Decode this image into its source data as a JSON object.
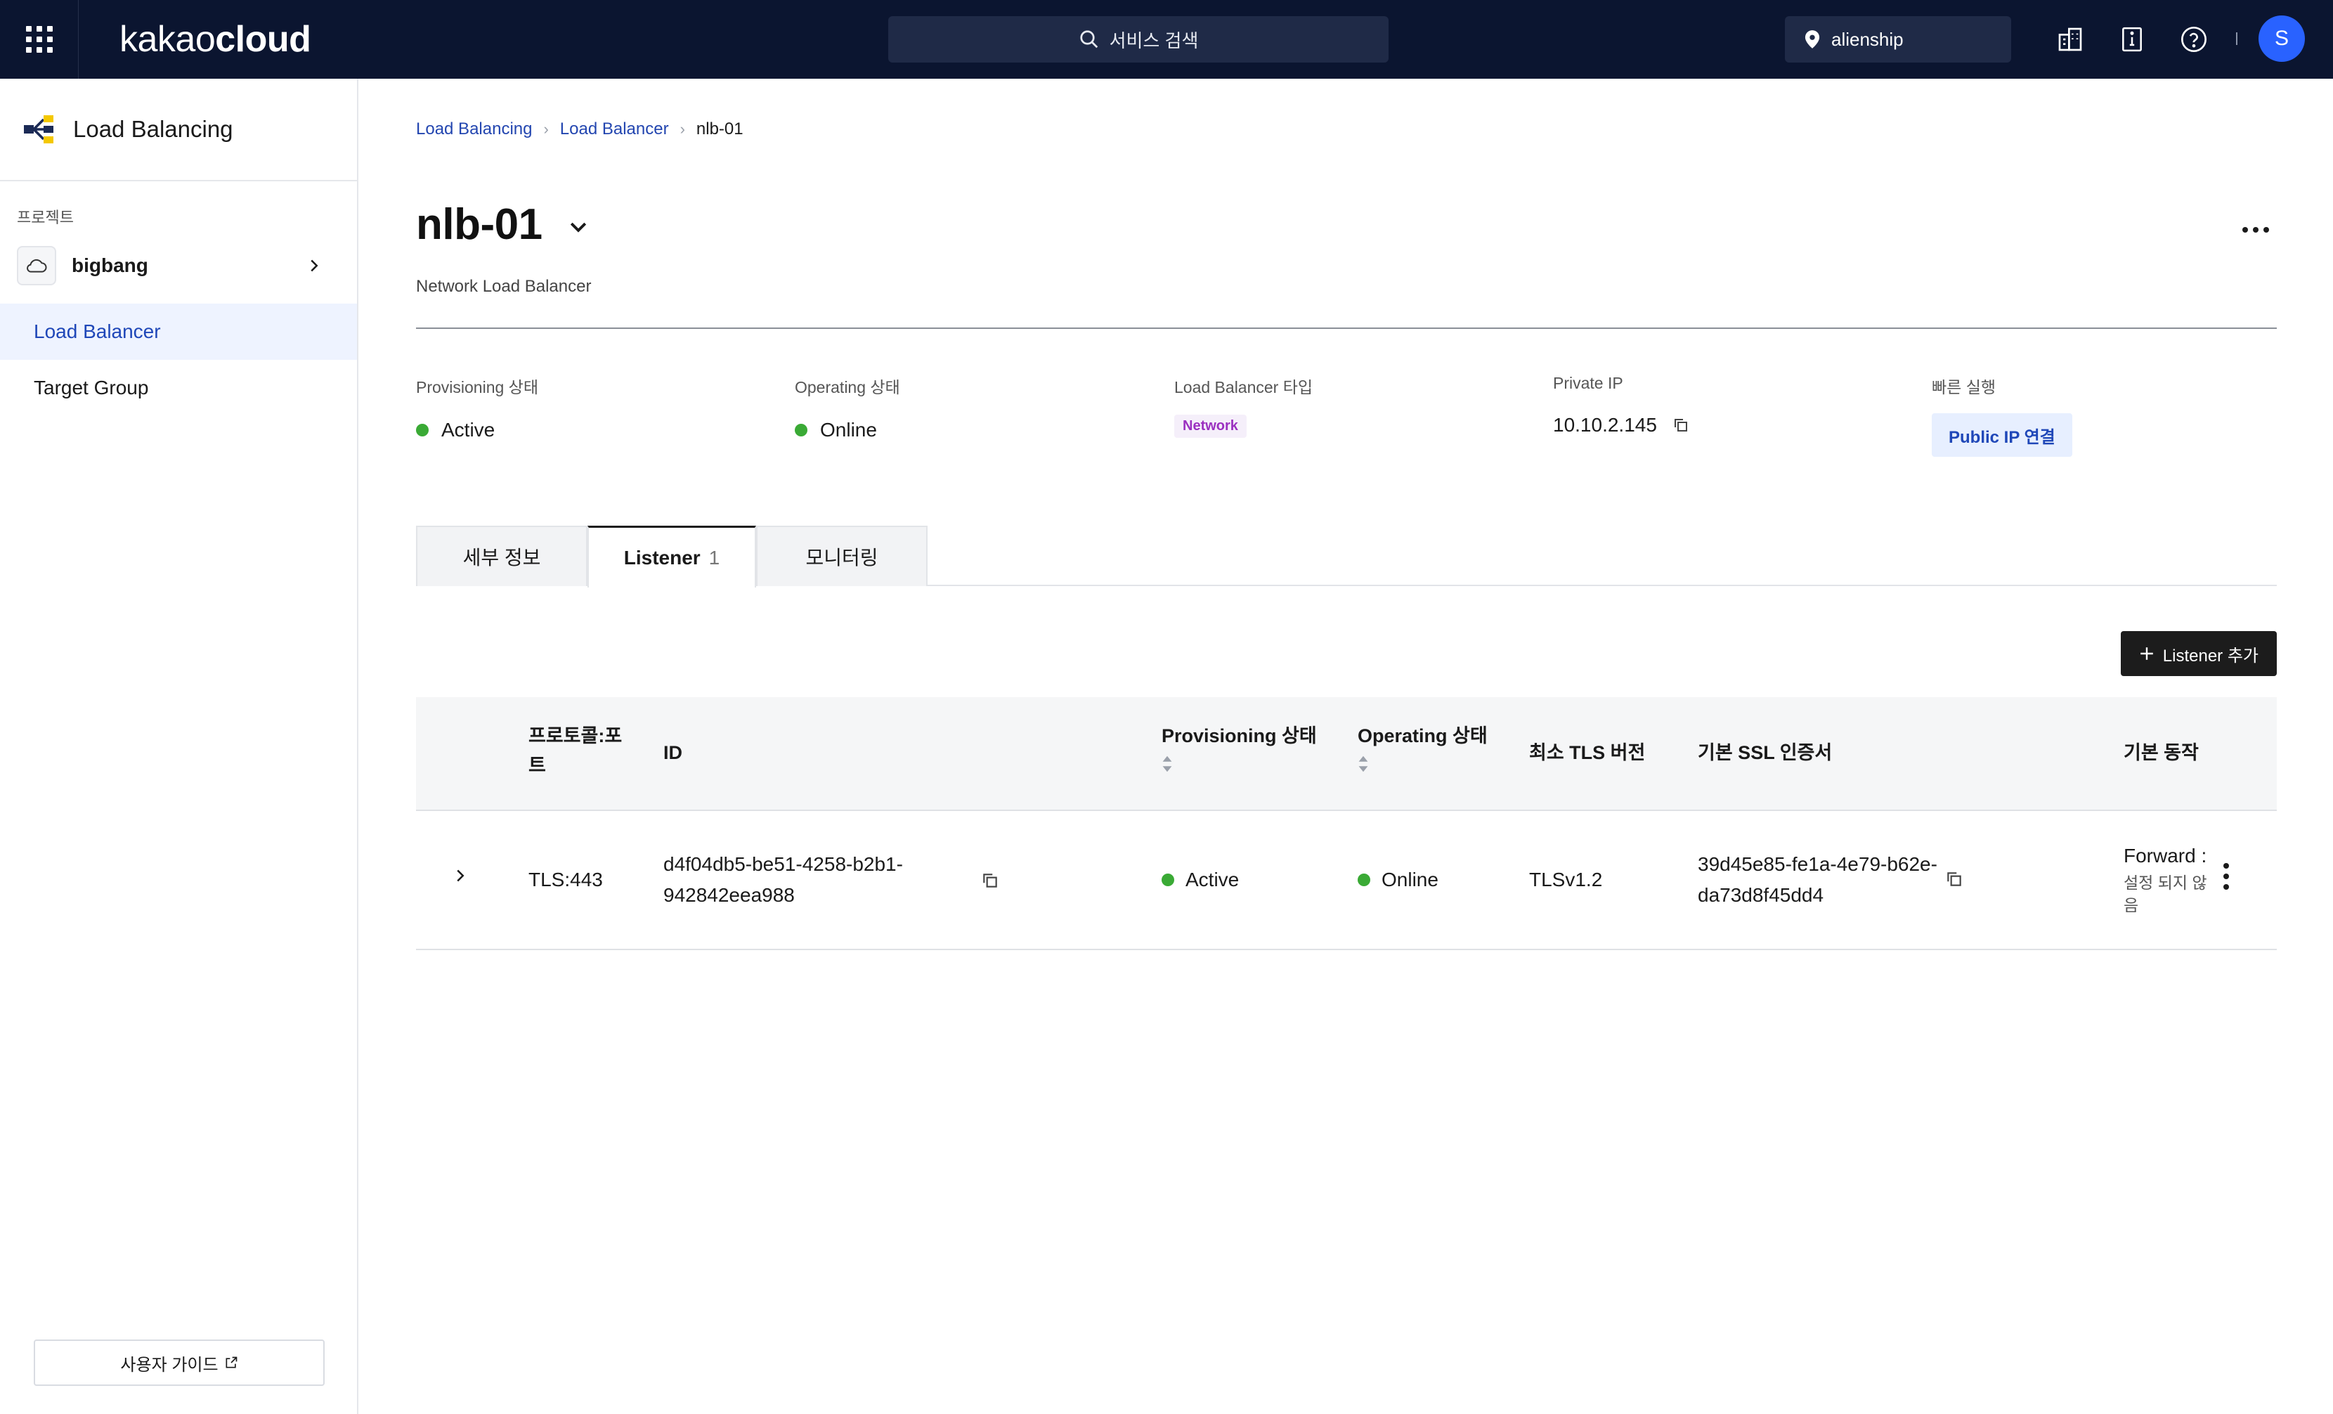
{
  "topbar": {
    "logo_light": "kakao",
    "logo_bold": "cloud",
    "search_placeholder": "서비스 검색",
    "project": "alienship",
    "avatar_initial": "S",
    "icons": [
      "apps-grid-icon",
      "search-icon",
      "location-pin-icon",
      "building-icon",
      "info-card-icon",
      "help-icon"
    ]
  },
  "sidebar": {
    "service_title": "Load Balancing",
    "section_label": "프로젝트",
    "project_name": "bigbang",
    "items": [
      {
        "label": "Load Balancer",
        "active": true
      },
      {
        "label": "Target Group",
        "active": false
      }
    ],
    "guide_label": "사용자 가이드"
  },
  "breadcrumb": [
    "Load Balancing",
    "Load Balancer",
    "nlb-01"
  ],
  "page": {
    "title": "nlb-01",
    "subtitle": "Network Load Balancer"
  },
  "summary": {
    "provisioning": {
      "label": "Provisioning 상태",
      "value": "Active"
    },
    "operating": {
      "label": "Operating 상태",
      "value": "Online"
    },
    "lb_type": {
      "label": "Load Balancer 타입",
      "value": "Network"
    },
    "private_ip": {
      "label": "Private IP",
      "value": "10.10.2.145"
    },
    "quick": {
      "label": "빠른 실행",
      "button": "Public IP 연결"
    }
  },
  "tabs": [
    {
      "label": "세부 정보"
    },
    {
      "label": "Listener",
      "count": "1",
      "active": true
    },
    {
      "label": "모니터링"
    }
  ],
  "add_listener_label": "Listener 추가",
  "table": {
    "headers": [
      "프로토콜:포트",
      "ID",
      "Provisioning 상태",
      "Operating 상태",
      "최소 TLS 버전",
      "기본 SSL 인증서",
      "기본 동작"
    ],
    "headers_wrapped": {
      "protocol_line1": "프로토콜:포",
      "protocol_line2": "트"
    },
    "rows": [
      {
        "protocol": "TLS:443",
        "id_line1": "d4f04db5-be51-4258-b2b1-",
        "id_line2": "942842eea988",
        "provisioning": "Active",
        "operating": "Online",
        "tls": "TLSv1.2",
        "ssl_line1": "39d45e85-fe1a-4e79-b62e-",
        "ssl_line2": "da73d8f45dd4",
        "action": "Forward :",
        "action_note_line1": "설정 되지 않",
        "action_note_line2": "음"
      }
    ]
  },
  "colors": {
    "topbar_bg": "#0b1530",
    "accent": "#2346b0",
    "status_green": "#3aaa35",
    "network_badge": "#9b30c0",
    "avatar": "#2962ff"
  }
}
